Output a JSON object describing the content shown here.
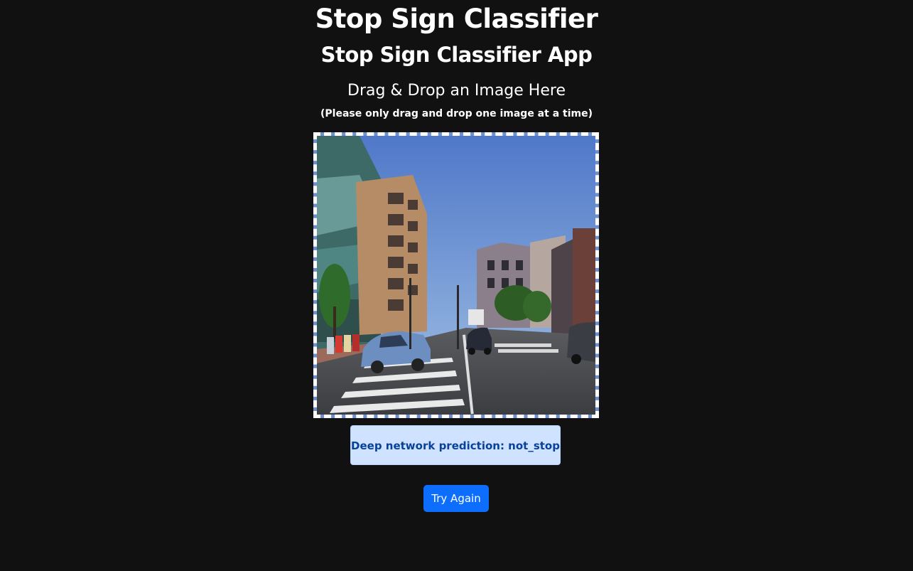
{
  "header": {
    "title": "Stop Sign Classifier",
    "subtitle": "Stop Sign Classifier App"
  },
  "drop_zone": {
    "heading": "Drag & Drop an Image Here",
    "hint": "(Please only drag and drop one image at a time)",
    "image_icon": "street-scene-image"
  },
  "result": {
    "prediction_text": "Deep network prediction: not_stop"
  },
  "actions": {
    "try_again_label": "Try Again"
  },
  "colors": {
    "background": "#111111",
    "alert_bg": "#cfe2ff",
    "alert_text": "#084298",
    "primary_button": "#0d6efd"
  }
}
